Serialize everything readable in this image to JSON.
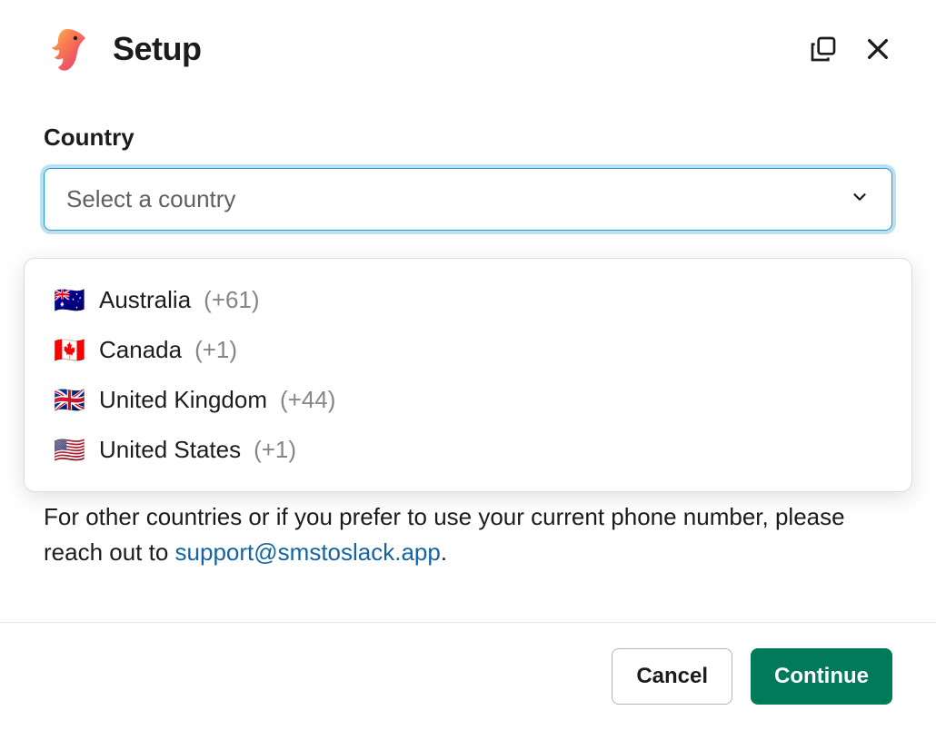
{
  "header": {
    "title": "Setup"
  },
  "field": {
    "label": "Country",
    "placeholder": "Select a country"
  },
  "options": [
    {
      "flag": "🇦🇺",
      "name": "Australia",
      "code": "(+61)"
    },
    {
      "flag": "🇨🇦",
      "name": "Canada",
      "code": "(+1)"
    },
    {
      "flag": "🇬🇧",
      "name": "United Kingdom",
      "code": "(+44)"
    },
    {
      "flag": "🇺🇸",
      "name": "United States",
      "code": "(+1)"
    }
  ],
  "help": {
    "text_before": "For other countries or if you prefer to use your current phone number, please reach out to ",
    "link_text": "support@smstoslack.app",
    "text_after": "."
  },
  "footer": {
    "cancel": "Cancel",
    "continue": "Continue"
  }
}
